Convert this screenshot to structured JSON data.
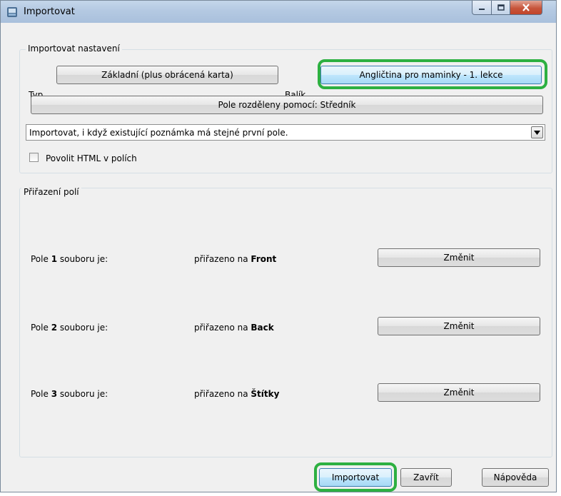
{
  "window": {
    "title": "Importovat",
    "controls": {
      "minimize": "minimize-icon",
      "maximize": "maximize-icon",
      "close": "close-icon"
    }
  },
  "import_settings": {
    "group_label": "Importovat nastavení",
    "type_label": "Typ",
    "type_value": "Základní (plus obrácená karta)",
    "deck_label": "Balík",
    "deck_value": "Angličtina pro maminky - 1. lekce",
    "separator_button": "Pole rozděleny pomocí: Středník",
    "duplicate_mode": "Importovat, i když existující poznámka má stejné první pole.",
    "allow_html_label": "Povolit HTML v polích",
    "allow_html_checked": false
  },
  "field_mapping": {
    "group_label": "Přiřazení polí",
    "fields": [
      {
        "prefix": "Pole ",
        "number": "1",
        "suffix": " souboru je:",
        "mapped_prefix": "přiřazeno na ",
        "mapped_to": "Front",
        "change_label": "Změnit"
      },
      {
        "prefix": "Pole ",
        "number": "2",
        "suffix": " souboru je:",
        "mapped_prefix": "přiřazeno na ",
        "mapped_to": "Back",
        "change_label": "Změnit"
      },
      {
        "prefix": "Pole ",
        "number": "3",
        "suffix": " souboru je:",
        "mapped_prefix": "přiřazeno na ",
        "mapped_to": "Štítky",
        "change_label": "Změnit"
      }
    ]
  },
  "footer": {
    "import_button": "Importovat",
    "close_button": "Zavřít",
    "help_button": "Nápověda"
  },
  "colors": {
    "highlight": "#2db041",
    "titlebar": "#b4c9e2",
    "close_button": "#c7553b"
  }
}
